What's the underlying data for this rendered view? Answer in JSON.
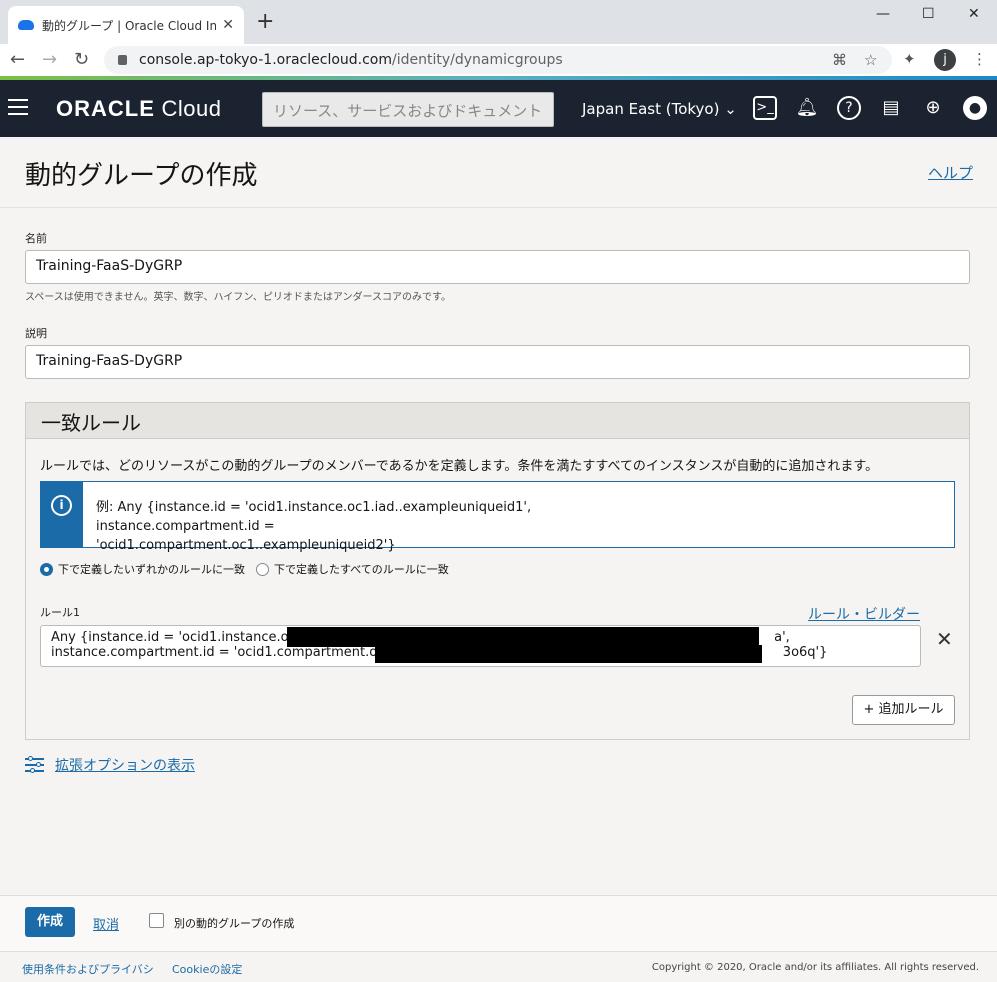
{
  "browser": {
    "tab_title": "動的グループ | Oracle Cloud Infrast",
    "url_host": "console.ap-tokyo-1.oraclecloud.com",
    "url_path": "/identity/dynamicgroups",
    "profile_initial": "j"
  },
  "header": {
    "logo_bold": "ORACLE",
    "logo_light": " Cloud",
    "search_placeholder": "リソース、サービスおよびドキュメント",
    "region": "Japan East (Tokyo) ⌄"
  },
  "page": {
    "title": "動的グループの作成",
    "help": "ヘルプ"
  },
  "form": {
    "name_label": "名前",
    "name_value": "Training-FaaS-DyGRP",
    "name_hint": "スペースは使用できません。英字、数字、ハイフン、ピリオドまたはアンダースコアのみです。",
    "desc_label": "説明",
    "desc_value": "Training-FaaS-DyGRP"
  },
  "rules": {
    "heading": "一致ルール",
    "description": "ルールでは、どのリソースがこの動的グループのメンバーであるかを定義します。条件を満たすすべてのインスタンスが自動的に追加されます。",
    "example_line1": "例: Any {instance.id = 'ocid1.instance.oc1.iad..exampleuniqueid1', instance.compartment.id =",
    "example_line2": "'ocid1.compartment.oc1..exampleuniqueid2'}",
    "radio_any": "下で定義したいずれかのルールに一致",
    "radio_all": "下で定義したすべてのルールに一致",
    "rule1_label": "ルール1",
    "rule_builder": "ルール・ビルダー",
    "rule1_line1_start": "Any {instance.id = 'ocid1.instance.oc1.",
    "rule1_line1_end": "a',",
    "rule1_line2_start": "instance.compartment.id = 'ocid1.compartment.oc1.",
    "rule1_line2_end": "3o6q'}",
    "add_rule": "+ 追加ルール"
  },
  "advanced": "拡張オプションの表示",
  "footer": {
    "create": "作成",
    "cancel": "取消",
    "create_another": "別の動的グループの作成"
  },
  "legal": {
    "terms": "使用条件およびプライバシ",
    "cookie": "Cookieの設定",
    "copyright": "Copyright © 2020, Oracle and/or its affiliates. All rights reserved."
  }
}
